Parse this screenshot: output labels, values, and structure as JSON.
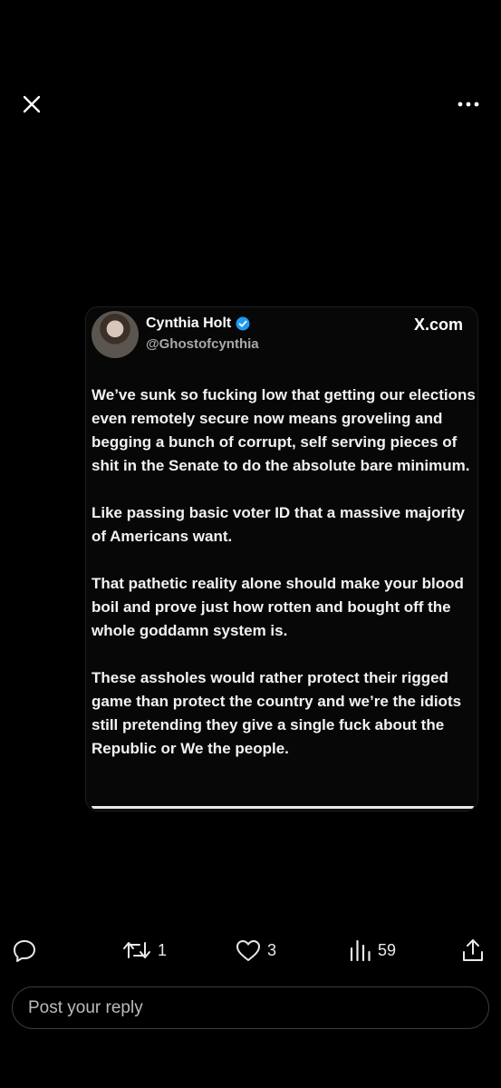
{
  "top_bar": {
    "close_icon": "close-icon",
    "more_icon": "more-options-icon"
  },
  "embedded_post": {
    "author_name": "Cynthia Holt",
    "author_handle": "@Ghostofcynthia",
    "verified": true,
    "site_label": "X.com",
    "paragraphs": [
      "We’ve sunk so fucking low that getting our elections even remotely secure now means groveling and begging a bunch of corrupt, self serving pieces of shit in the Senate to do the absolute bare minimum.",
      "Like passing basic voter ID that a massive majority of Americans want.",
      "That pathetic reality alone should make your blood boil and prove just how rotten and bought off the whole goddamn system is.",
      "These assholes would rather protect their rigged game than protect the country and we’re the idiots still pretending they give a single fuck about the Republic or We the people."
    ]
  },
  "actions": {
    "reply_count": "",
    "repost_count": "1",
    "like_count": "3",
    "view_count": "59"
  },
  "reply": {
    "placeholder": "Post your reply"
  },
  "colors": {
    "background": "#000000",
    "text": "#e7e9ea",
    "verified_badge": "#1d9bf0"
  }
}
